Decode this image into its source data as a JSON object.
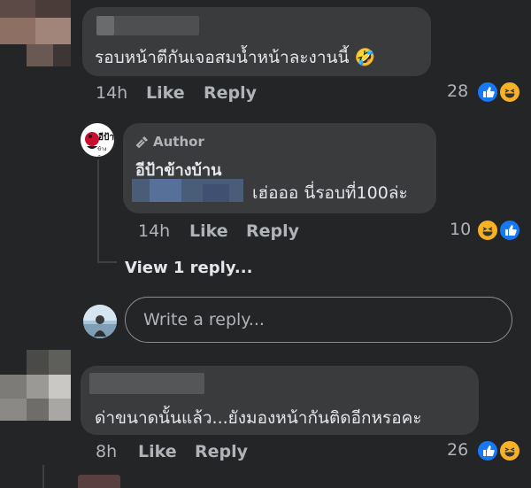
{
  "comments": [
    {
      "text": "รอบหน้าตีกันเจอสมน้ำหน้าละงานนี้ 🤣",
      "time": "14h",
      "like_label": "Like",
      "reply_label": "Reply",
      "reaction_count": "28",
      "reactions": [
        "like-icon",
        "haha-icon"
      ]
    },
    {
      "badge_label": "Author",
      "author": "อีป้าข้างบ้าน",
      "text": "เฮ่อออ นี่รอบที่100ล่ะ",
      "time": "14h",
      "like_label": "Like",
      "reply_label": "Reply",
      "reaction_count": "10",
      "reactions": [
        "haha-icon",
        "like-icon"
      ],
      "avatar_text": "อีป้า",
      "avatar_subtext": "ข้างบ้าน"
    },
    {
      "text": "ด่าขนาดนั้นแล้ว...ยังมองหน้ากันติดอีกหรอคะ",
      "time": "8h",
      "like_label": "Like",
      "reply_label": "Reply",
      "reaction_count": "26",
      "reactions": [
        "like-icon",
        "haha-icon"
      ]
    }
  ],
  "view_replies_label": "View 1 reply...",
  "reply_input": {
    "placeholder": "Write a reply..."
  },
  "colors": {
    "background": "#242526",
    "bubble": "#3a3b3c",
    "text": "#e4e6eb",
    "muted": "#b0b3b8",
    "like_blue": "#1877f2",
    "haha_yellow": "#f7b125"
  }
}
